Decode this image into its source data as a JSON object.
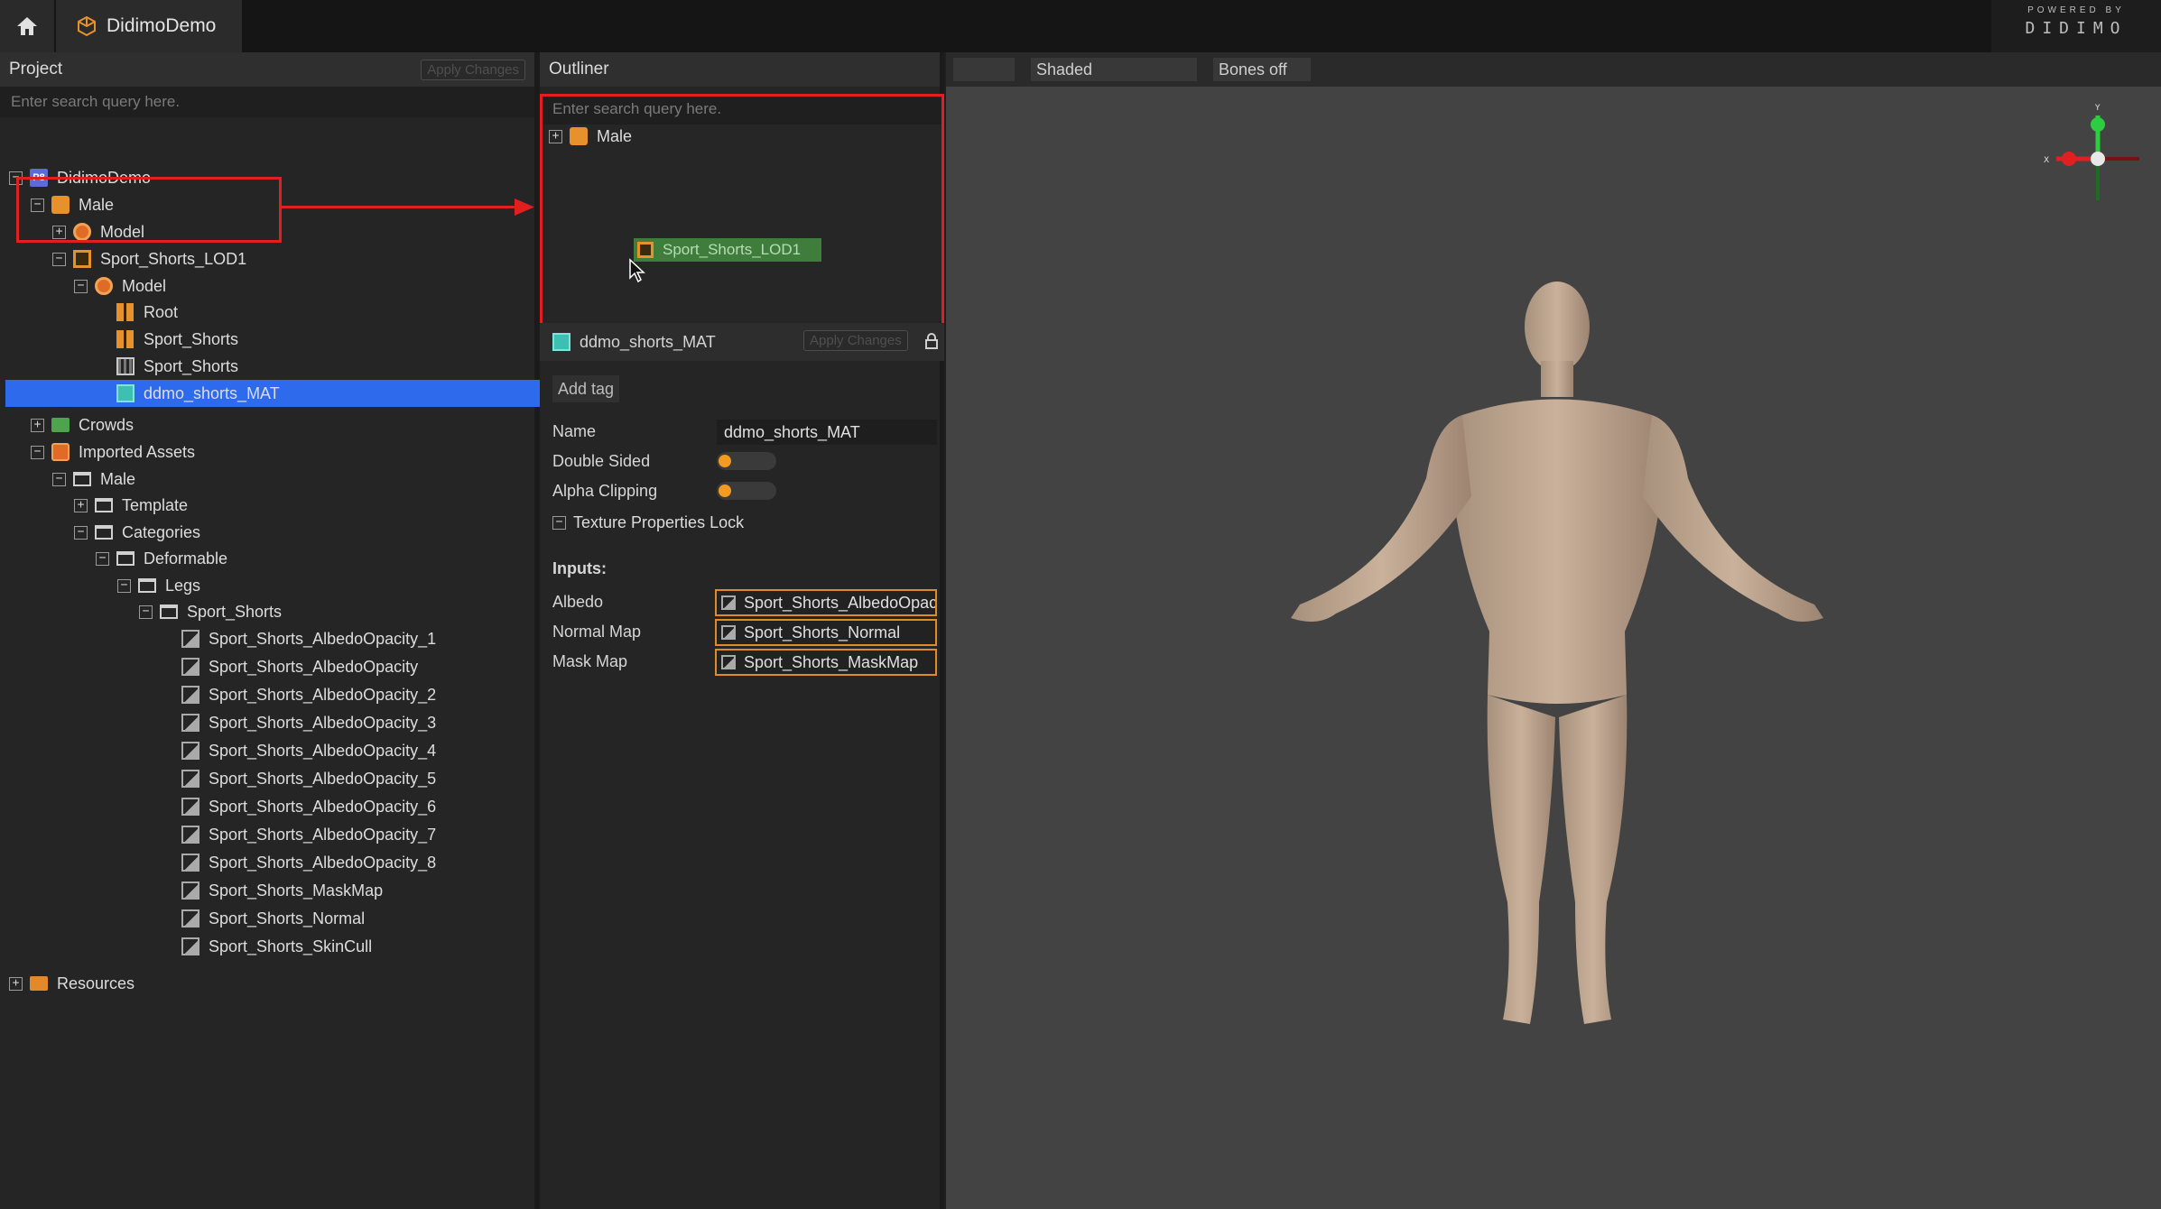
{
  "app": {
    "tab_title": "DidimoDemo",
    "brand_small": "POWERED BY",
    "brand_big": "DIDIMO"
  },
  "project": {
    "title": "Project",
    "apply_label": "Apply Changes",
    "search_placeholder": "Enter search query here.",
    "tree": [
      {
        "label": "DidimoDemo",
        "icon": "project-icon",
        "depth": 0,
        "exp": "−"
      },
      {
        "label": "Male",
        "icon": "character-icon",
        "depth": 1,
        "exp": "−"
      },
      {
        "label": "Model",
        "icon": "model-icon",
        "depth": 2,
        "exp": "+"
      },
      {
        "label": "Sport_Shorts_LOD1",
        "icon": "lod-icon",
        "depth": 2,
        "exp": "−"
      },
      {
        "label": "Model",
        "icon": "model-icon",
        "depth": 3,
        "exp": "−"
      },
      {
        "label": "Root",
        "icon": "skeleton-icon",
        "depth": 4,
        "exp": ""
      },
      {
        "label": "Sport_Shorts",
        "icon": "skeleton-icon",
        "depth": 4,
        "exp": ""
      },
      {
        "label": "Sport_Shorts",
        "icon": "mesh-icon",
        "depth": 4,
        "exp": ""
      },
      {
        "label": "ddmo_shorts_MAT",
        "icon": "material-icon",
        "depth": 4,
        "exp": "",
        "selected": true
      },
      {
        "label": "Crowds",
        "icon": "crowds-icon",
        "depth": 1,
        "exp": "+"
      },
      {
        "label": "Imported Assets",
        "icon": "imported-icon",
        "depth": 1,
        "exp": "−"
      },
      {
        "label": "Male",
        "icon": "folder-icon",
        "depth": 2,
        "exp": "−"
      },
      {
        "label": "Template",
        "icon": "folder-icon",
        "depth": 3,
        "exp": "+"
      },
      {
        "label": "Categories",
        "icon": "folder-icon",
        "depth": 3,
        "exp": "−"
      },
      {
        "label": "Deformable",
        "icon": "folder-icon",
        "depth": 4,
        "exp": "−"
      },
      {
        "label": "Legs",
        "icon": "folder-icon",
        "depth": 5,
        "exp": "−"
      },
      {
        "label": "Sport_Shorts",
        "icon": "folder-icon",
        "depth": 6,
        "exp": "−"
      },
      {
        "label": "Sport_Shorts_AlbedoOpacity_1",
        "icon": "image-icon",
        "depth": 7,
        "exp": ""
      },
      {
        "label": "Sport_Shorts_AlbedoOpacity",
        "icon": "image-icon",
        "depth": 7,
        "exp": ""
      },
      {
        "label": "Sport_Shorts_AlbedoOpacity_2",
        "icon": "image-icon",
        "depth": 7,
        "exp": ""
      },
      {
        "label": "Sport_Shorts_AlbedoOpacity_3",
        "icon": "image-icon",
        "depth": 7,
        "exp": ""
      },
      {
        "label": "Sport_Shorts_AlbedoOpacity_4",
        "icon": "image-icon",
        "depth": 7,
        "exp": ""
      },
      {
        "label": "Sport_Shorts_AlbedoOpacity_5",
        "icon": "image-icon",
        "depth": 7,
        "exp": ""
      },
      {
        "label": "Sport_Shorts_AlbedoOpacity_6",
        "icon": "image-icon",
        "depth": 7,
        "exp": ""
      },
      {
        "label": "Sport_Shorts_AlbedoOpacity_7",
        "icon": "image-icon",
        "depth": 7,
        "exp": ""
      },
      {
        "label": "Sport_Shorts_AlbedoOpacity_8",
        "icon": "image-icon",
        "depth": 7,
        "exp": ""
      },
      {
        "label": "Sport_Shorts_MaskMap",
        "icon": "image-icon",
        "depth": 7,
        "exp": ""
      },
      {
        "label": "Sport_Shorts_Normal",
        "icon": "image-icon",
        "depth": 7,
        "exp": ""
      },
      {
        "label": "Sport_Shorts_SkinCull",
        "icon": "image-icon",
        "depth": 7,
        "exp": ""
      },
      {
        "label": "Resources",
        "icon": "resources-icon",
        "depth": 0,
        "exp": "+"
      }
    ]
  },
  "outliner": {
    "title": "Outliner",
    "search_placeholder": "Enter search query here.",
    "root_label": "Male",
    "drag_label": "Sport_Shorts_LOD1"
  },
  "material": {
    "name_header": "ddmo_shorts_MAT",
    "apply_label": "Apply Changes",
    "add_tag": "Add tag",
    "name_label": "Name",
    "name_value": "ddmo_shorts_MAT",
    "double_sided_label": "Double Sided",
    "alpha_clipping_label": "Alpha Clipping",
    "texture_lock_label": "Texture Properties Lock",
    "inputs_label": "Inputs:",
    "albedo_label": "Albedo",
    "albedo_value": "Sport_Shorts_AlbedoOpac",
    "normal_label": "Normal Map",
    "normal_value": "Sport_Shorts_Normal",
    "mask_label": "Mask Map",
    "mask_value": "Sport_Shorts_MaskMap"
  },
  "viewport": {
    "shading_label": "Shaded",
    "bones_label": "Bones off",
    "gizmo_y": "Y",
    "gizmo_x": "X"
  }
}
